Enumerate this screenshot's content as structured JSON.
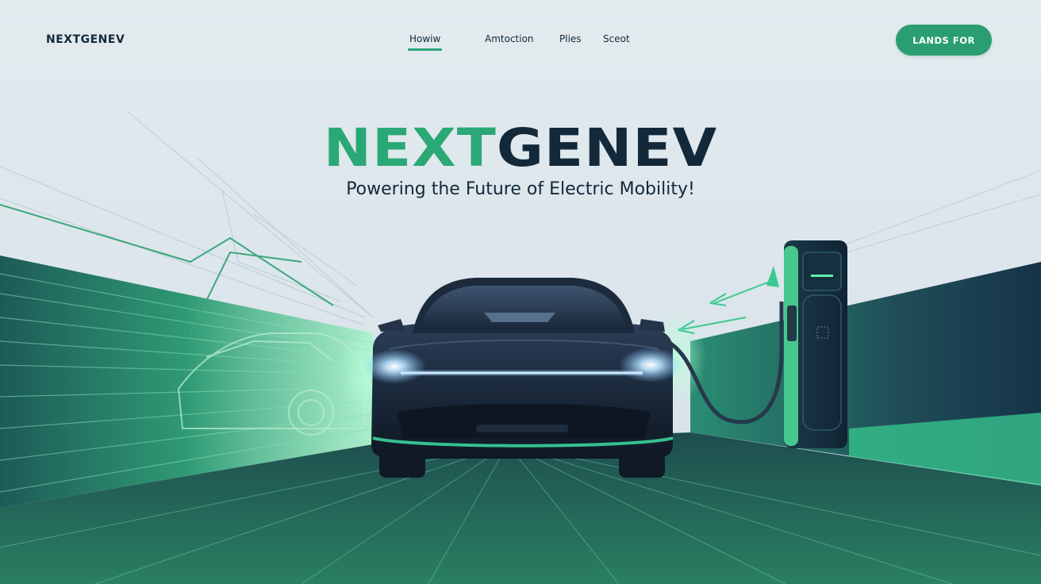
{
  "header": {
    "logo": "NEXTGENEV",
    "nav": [
      {
        "label": "Howiw",
        "active": true
      },
      {
        "label": "Amtoction",
        "active": false
      },
      {
        "label": "Plies",
        "active": false
      },
      {
        "label": "Sceot",
        "active": false
      }
    ],
    "cta_label": "LANDS FOR"
  },
  "hero": {
    "title_part1": "NEXT",
    "title_part2": "GENEV",
    "tagline": "Powering the Future of Electric Mobility!"
  },
  "colors": {
    "accent": "#2aa876",
    "dark": "#13293a",
    "button": "#2a9e72",
    "background": "#e3ebef"
  },
  "icons": [
    "car-illustration",
    "charging-station-icon",
    "arrow-icon"
  ]
}
